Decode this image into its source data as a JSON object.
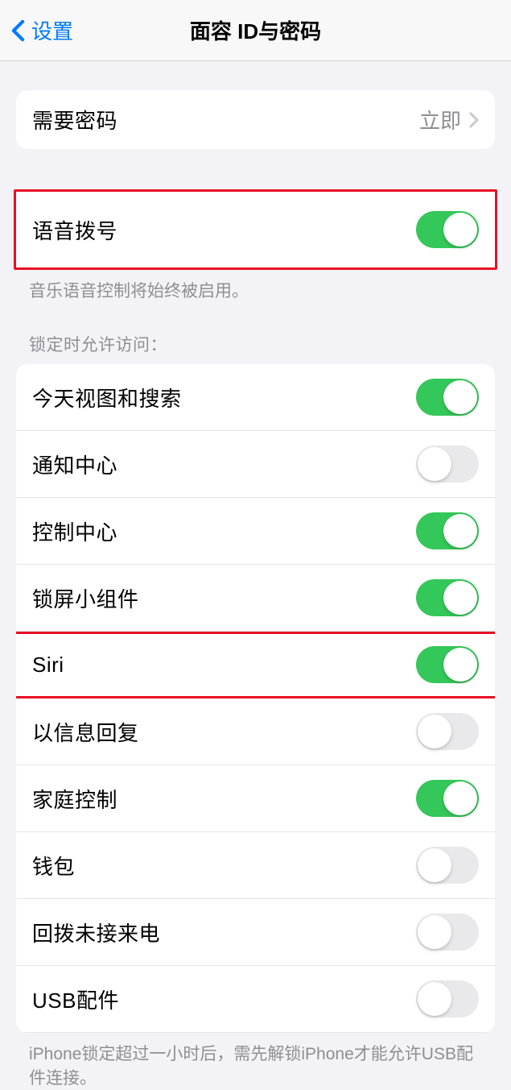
{
  "header": {
    "back_label": "设置",
    "title": "面容 ID与密码"
  },
  "passcode_group": {
    "require_label": "需要密码",
    "require_value": "立即"
  },
  "voice_dial": {
    "label": "语音拨号",
    "enabled": true,
    "footer": "音乐语音控制将始终被启用。"
  },
  "lock_access": {
    "header": "锁定时允许访问：",
    "items": [
      {
        "label": "今天视图和搜索",
        "enabled": true
      },
      {
        "label": "通知中心",
        "enabled": false
      },
      {
        "label": "控制中心",
        "enabled": true
      },
      {
        "label": "锁屏小组件",
        "enabled": true
      },
      {
        "label": "Siri",
        "enabled": true
      },
      {
        "label": "以信息回复",
        "enabled": false
      },
      {
        "label": "家庭控制",
        "enabled": true
      },
      {
        "label": "钱包",
        "enabled": false
      },
      {
        "label": "回拨未接来电",
        "enabled": false
      },
      {
        "label": "USB配件",
        "enabled": false
      }
    ],
    "footer": "iPhone锁定超过一小时后，需先解锁iPhone才能允许USB配件连接。"
  }
}
